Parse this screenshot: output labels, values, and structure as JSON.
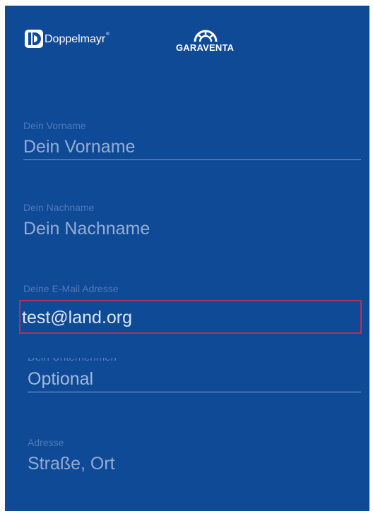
{
  "logos": {
    "doppelmayr": {
      "mark": "D",
      "text": "Doppelmayr",
      "reg": "®"
    },
    "garaventa": {
      "text": "GARAVENTA",
      "mark_icon": "garaventa-wheel-icon"
    }
  },
  "form": {
    "first_name": {
      "label": "Dein Vorname",
      "placeholder": "Dein Vorname"
    },
    "last_name": {
      "label": "Dein Nachname",
      "placeholder": "Dein Nachname"
    },
    "email": {
      "label": "Deine E-Mail Adresse",
      "value": "test@land.org"
    },
    "company": {
      "label": "Dein Unternehmen",
      "placeholder": "Optional"
    },
    "address": {
      "label": "Adresse",
      "placeholder": "Straße, Ort"
    }
  },
  "colors": {
    "background": "#0f4a96",
    "label": "#4f79b9",
    "placeholder": "#95add3",
    "error_border": "#b0315e"
  }
}
